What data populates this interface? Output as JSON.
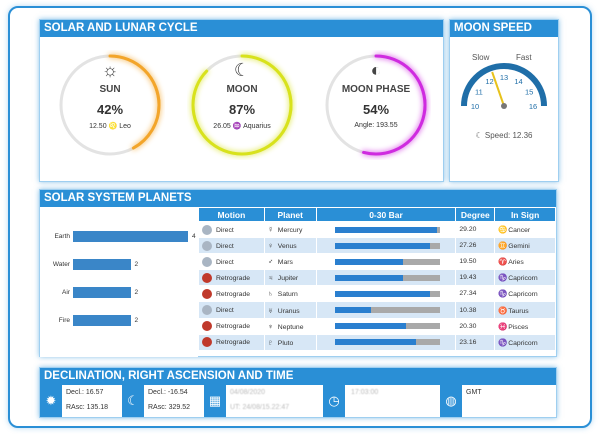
{
  "solar_lunar": {
    "title": "SOLAR AND LUNAR CYCLE",
    "sun": {
      "name": "SUN",
      "icon": "sun-icon",
      "percent": "42%",
      "fraction": 0.42,
      "degree": "12.50",
      "sign_glyph": "♌",
      "sign": "Leo",
      "color": "#f3a52a"
    },
    "moon": {
      "name": "MOON",
      "icon": "crescent-moon-icon",
      "percent": "87%",
      "fraction": 0.87,
      "degree": "26.05",
      "sign_glyph": "♒",
      "sign": "Aquarius",
      "color": "#d8e21c"
    },
    "phase": {
      "name": "MOON PHASE",
      "icon": "moon-phase-icon",
      "percent": "54%",
      "fraction": 0.54,
      "angle_label": "Angle: 193.55",
      "color": "#cf2be0"
    }
  },
  "moon_speed": {
    "title": "MOON SPEED",
    "slow_label": "Slow",
    "fast_label": "Fast",
    "ticks": [
      "10",
      "11",
      "12",
      "13",
      "14",
      "15",
      "16"
    ],
    "speed_value": 12.36,
    "speed_text": "Speed: 12.36",
    "icon": "crescent-moon-icon",
    "accent": "#1f6ea8"
  },
  "planets": {
    "title": "SOLAR SYSTEM PLANETS",
    "elements_chart": {
      "categories": [
        "Earth",
        "Water",
        "Air",
        "Fire"
      ],
      "values": [
        4,
        2,
        2,
        2
      ],
      "value_labels": [
        "4",
        "2",
        "2",
        "2"
      ],
      "max": 4
    },
    "columns": [
      "Motion",
      "Planet",
      "0-30 Bar",
      "Degree",
      "In Sign"
    ],
    "rows": [
      {
        "motion": "Direct",
        "badge": "D",
        "planet_glyph": "☿",
        "planet": "Mercury",
        "degree": "29.20",
        "bar": 29.2,
        "sign_glyph": "♋",
        "sign": "Cancer"
      },
      {
        "motion": "Direct",
        "badge": "D",
        "planet_glyph": "♀",
        "planet": "Venus",
        "degree": "27.26",
        "bar": 27.26,
        "sign_glyph": "♊",
        "sign": "Gemini"
      },
      {
        "motion": "Direct",
        "badge": "D",
        "planet_glyph": "♂",
        "planet": "Mars",
        "degree": "19.50",
        "bar": 19.5,
        "sign_glyph": "♈",
        "sign": "Aries"
      },
      {
        "motion": "Retrograde",
        "badge": "R",
        "planet_glyph": "♃",
        "planet": "Jupiter",
        "degree": "19.43",
        "bar": 19.43,
        "sign_glyph": "♑",
        "sign": "Capricorn"
      },
      {
        "motion": "Retrograde",
        "badge": "R",
        "planet_glyph": "♄",
        "planet": "Saturn",
        "degree": "27.34",
        "bar": 27.34,
        "sign_glyph": "♑",
        "sign": "Capricorn"
      },
      {
        "motion": "Direct",
        "badge": "D",
        "planet_glyph": "♅",
        "planet": "Uranus",
        "degree": "10.38",
        "bar": 10.38,
        "sign_glyph": "♉",
        "sign": "Taurus"
      },
      {
        "motion": "Retrograde",
        "badge": "R",
        "planet_glyph": "♆",
        "planet": "Neptune",
        "degree": "20.30",
        "bar": 20.3,
        "sign_glyph": "♓",
        "sign": "Pisces"
      },
      {
        "motion": "Retrograde",
        "badge": "R",
        "planet_glyph": "♇",
        "planet": "Pluto",
        "degree": "23.16",
        "bar": 23.16,
        "sign_glyph": "♑",
        "sign": "Capricorn"
      }
    ]
  },
  "declination": {
    "title": "DECLINATION, RIGHT ASCENSION AND TIME",
    "sun_decl": "Decl.: 16.57",
    "sun_rasc": "RAsc: 135.18",
    "moon_decl": "Decl.: -16.54",
    "moon_rasc": "RAsc: 329.52",
    "date_line1": "04/08/2020",
    "date_line2": "UT: 24/08/15.22:47",
    "time_line": "17:03:00",
    "tz_label": "GMT",
    "icons": [
      "sun-gear-icon",
      "crescent-moon-icon",
      "calendar-icon",
      "clock-icon",
      "globe-icon"
    ]
  }
}
